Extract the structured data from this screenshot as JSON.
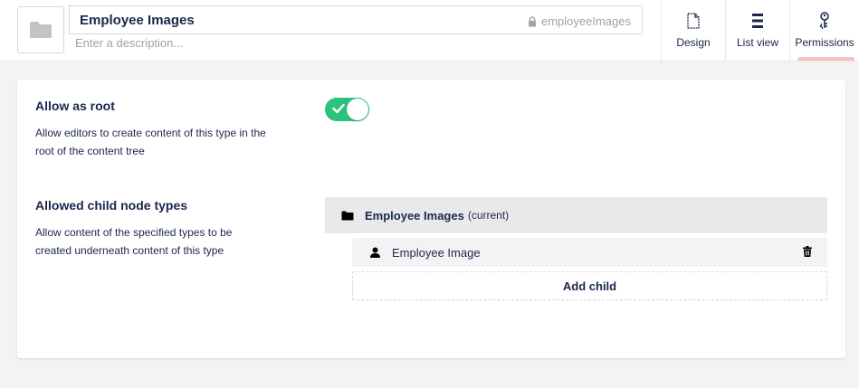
{
  "header": {
    "name": "Employee Images",
    "alias": "employeeImages",
    "description_placeholder": "Enter a description...",
    "icon": "folder-icon"
  },
  "apps": [
    {
      "label": "Design",
      "icon": "document-icon",
      "active": false
    },
    {
      "label": "List view",
      "icon": "list-icon",
      "active": false
    },
    {
      "label": "Permissions",
      "icon": "key-icon",
      "active": true
    }
  ],
  "allow_root": {
    "title": "Allow as root",
    "description": "Allow editors to create content of this type in the root of the content tree",
    "enabled": true
  },
  "allowed_children": {
    "title": "Allowed child node types",
    "description": "Allow content of the specified types to be created underneath content of this type",
    "current": {
      "label": "Employee Images",
      "suffix": "(current)",
      "icon": "folder-icon"
    },
    "items": [
      {
        "label": "Employee Image",
        "icon": "user-icon"
      }
    ],
    "add_label": "Add child"
  },
  "colors": {
    "accent": "#2bc37c",
    "text": "#1b264f",
    "active_tab": "#f5c1bc"
  }
}
